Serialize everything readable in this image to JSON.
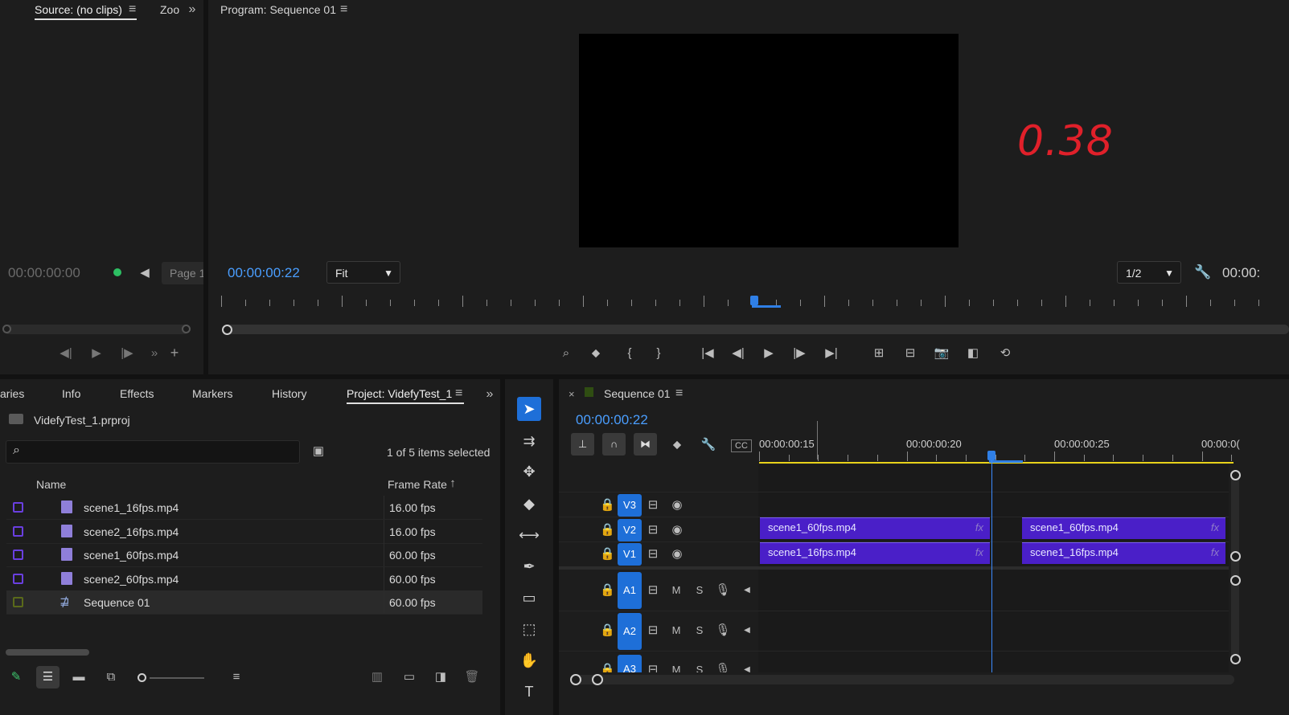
{
  "source_monitor": {
    "tab_label": "Source: (no clips)",
    "zoom_tab": "Zoo",
    "timecode": "00:00:00:00",
    "page_label": "Page 1"
  },
  "program_monitor": {
    "tab_label": "Program: Sequence 01",
    "timecode": "00:00:00:22",
    "fit_value": "Fit",
    "resolution_value": "1/2",
    "duration_partial": "00:00:",
    "handwritten_note": "0.38"
  },
  "project_panel": {
    "tabs": [
      "aries",
      "Info",
      "Effects",
      "Markers",
      "History",
      "Project: VidefyTest_1"
    ],
    "project_file": "VidefyTest_1.prproj",
    "search_placeholder": "",
    "selection_status": "1 of 5 items selected",
    "col_name": "Name",
    "col_frame_rate": "Frame Rate",
    "items": [
      {
        "name": "scene1_16fps.mp4",
        "frame_rate": "16.00 fps",
        "color": "#6a3fe0"
      },
      {
        "name": "scene2_16fps.mp4",
        "frame_rate": "16.00 fps",
        "color": "#6a3fe0"
      },
      {
        "name": "scene1_60fps.mp4",
        "frame_rate": "60.00 fps",
        "color": "#6a3fe0"
      },
      {
        "name": "scene2_60fps.mp4",
        "frame_rate": "60.00 fps",
        "color": "#6a3fe0"
      },
      {
        "name": "Sequence 01",
        "frame_rate": "60.00 fps",
        "color": "#5a6a1a"
      }
    ]
  },
  "timeline": {
    "close_glyph": "×",
    "tab_label": "Sequence 01",
    "timecode": "00:00:00:22",
    "ruler": [
      "00:00:00:15",
      "00:00:00:20",
      "00:00:00:25",
      "00:00:0("
    ],
    "video_tracks": [
      "V3",
      "V2",
      "V1"
    ],
    "audio_tracks": [
      "A1",
      "A2",
      "A3"
    ],
    "mute_label": "M",
    "solo_label": "S",
    "clips": {
      "v2_a": "scene1_60fps.mp4",
      "v2_b": "scene1_60fps.mp4",
      "v1_a": "scene1_16fps.mp4",
      "v1_b": "scene1_16fps.mp4",
      "fx": "fx"
    }
  },
  "colors": {
    "accent_blue": "#4a9eff",
    "clip_purple": "#4a1fc8",
    "track_blue": "#1e6fd8",
    "handwriting_red": "#e0202a"
  }
}
